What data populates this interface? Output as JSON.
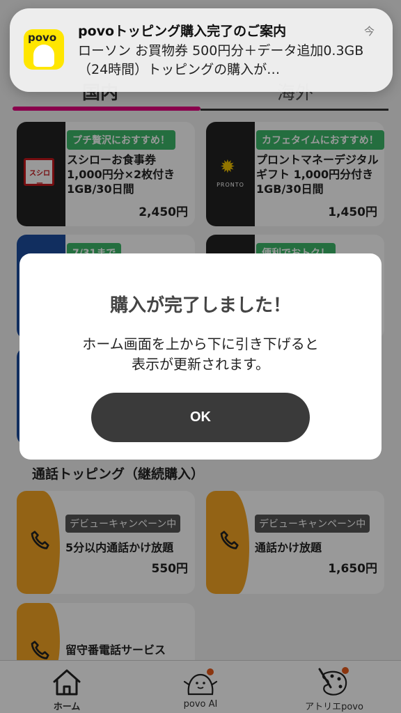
{
  "tabs": [
    {
      "label": "国内",
      "selected": true
    },
    {
      "label": "海外",
      "selected": false
    }
  ],
  "cards": [
    {
      "tag": "プチ贅沢におすすめ！",
      "name": "スシローお食事券 1,000円分×2枚付き 1GB/30日間",
      "price": "2,450円",
      "logo_text": "スシロー"
    },
    {
      "tag": "カフェタイムにおすすめ！",
      "name": "プロントマネーデジタルギフト 1,000円分付き 1GB/30日間",
      "price": "1,450円",
      "logo_text": "PRONTO"
    },
    {
      "tag": "7/31まで"
    },
    {
      "tag": "便利でおトク！"
    }
  ],
  "section_call": {
    "title": "通話トッピング（継続購入）"
  },
  "call_cards": [
    {
      "tag": "デビューキャンペーン中",
      "name": "5分以内通話かけ放題",
      "price": "550円"
    },
    {
      "tag": "デビューキャンペーン中",
      "name": "通話かけ放題",
      "price": "1,650円"
    },
    {
      "name": "留守番電話サービス"
    }
  ],
  "bottom_nav": [
    {
      "label": "ホーム",
      "icon": "home-icon",
      "selected": true
    },
    {
      "label": "povo AI",
      "icon": "povo-ai-icon",
      "selected": false
    },
    {
      "label": "アトリエpovo",
      "icon": "atelier-icon",
      "selected": false
    }
  ],
  "notification": {
    "app_brand": "povo",
    "title": "povoトッピング購入完了のご案内",
    "time": "今",
    "body": "ローソン お買物券 500円分＋データ追加0.3GB（24時間）トッピングの購入が…"
  },
  "dialog": {
    "title": "購入が完了しました！",
    "message_line1": "ホーム画面を上から下に引き下げると",
    "message_line2": "表示が更新されます。",
    "ok_label": "OK"
  },
  "colors": {
    "povo_yellow": "#ffe600",
    "tab_accent": "#e4007f",
    "tag_green": "#3db86a",
    "call_orange": "#f5a623",
    "button_dark": "#3a3a3a"
  }
}
